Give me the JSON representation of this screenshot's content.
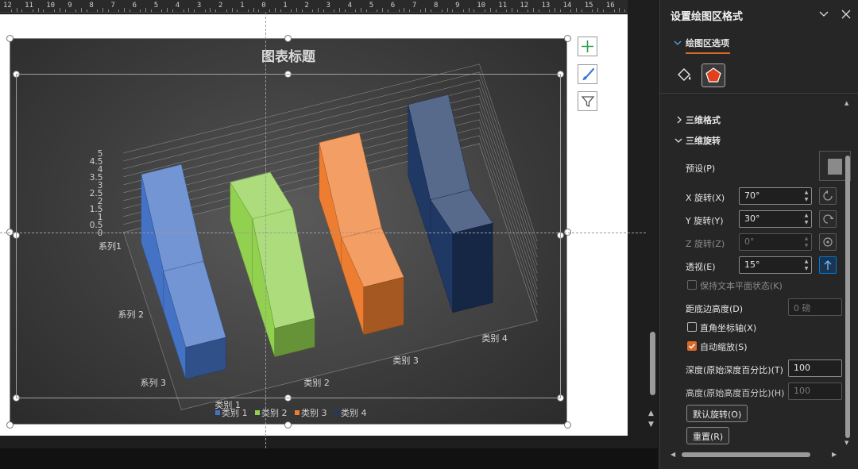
{
  "ruler": {
    "labels": [
      "12",
      "11",
      "10",
      "9",
      "8",
      "7",
      "6",
      "5",
      "4",
      "3",
      "2",
      "1",
      "0",
      "1",
      "2",
      "3",
      "4",
      "5",
      "6",
      "7",
      "8",
      "9",
      "10",
      "11",
      "12",
      "13",
      "14",
      "15",
      "16"
    ]
  },
  "chart": {
    "title": "图表标题",
    "tool_icons": [
      "plus-icon",
      "paintbrush-icon",
      "filter-icon"
    ]
  },
  "chart_data": {
    "type": "bar",
    "subtype": "3d-ribbon",
    "title": "图表标题",
    "categories": [
      "类别 1",
      "类别 2",
      "类别 3",
      "类别 4"
    ],
    "depth_labels": [
      "系列1",
      "系列 2",
      "系列 3"
    ],
    "y_ticks": [
      "0",
      "0.5",
      "1",
      "1.5",
      "2",
      "2.5",
      "3",
      "3.5",
      "4",
      "4.5",
      "5"
    ],
    "ylim": [
      0,
      5
    ],
    "series": [
      {
        "name": "类别 1",
        "color": "#4472c4",
        "values": [
          4.3,
          2.5,
          2.0
        ]
      },
      {
        "name": "类别 2",
        "color": "#92d050",
        "values": [
          2.4,
          4.4,
          1.8
        ]
      },
      {
        "name": "类别 3",
        "color": "#ed7d31",
        "values": [
          3.5,
          1.8,
          3.0
        ]
      },
      {
        "name": "类别 4",
        "color": "#203864",
        "values": [
          4.5,
          2.8,
          5.0
        ]
      }
    ],
    "legend": {
      "position": "bottom",
      "items": [
        "类别 1",
        "类别 2",
        "类别 3",
        "类别 4"
      ]
    },
    "grid": true
  },
  "pane": {
    "title": "设置绘图区格式",
    "section_tab": "绘图区选项",
    "groups": {
      "three_d_format": "三维格式",
      "three_d_rotation": "三维旋转"
    },
    "preset_label": "预设(P)",
    "x_rotation": {
      "label": "X 旋转(X)",
      "value": "70°"
    },
    "y_rotation": {
      "label": "Y 旋转(Y)",
      "value": "30°"
    },
    "z_rotation": {
      "label": "Z 旋转(Z)",
      "value": "0°"
    },
    "perspective": {
      "label": "透视(E)",
      "value": "15°"
    },
    "keep_text_flat": "保持文本平面状态(K)",
    "distance_from_ground": {
      "label": "距底边高度(D)",
      "value": "0 磅"
    },
    "right_angle_axes": "直角坐标轴(X)",
    "autoscale": "自动缩放(S)",
    "depth": {
      "label": "深度(原始深度百分比)(T)",
      "value": "100"
    },
    "height": {
      "label": "高度(原始高度百分比)(H)",
      "value": "100"
    },
    "default_rotation_button": "默认旋转(O)",
    "reset_button": "重置(R)"
  },
  "colors": {
    "accent": "#d9692b",
    "perspective_button": "#0078d4"
  }
}
